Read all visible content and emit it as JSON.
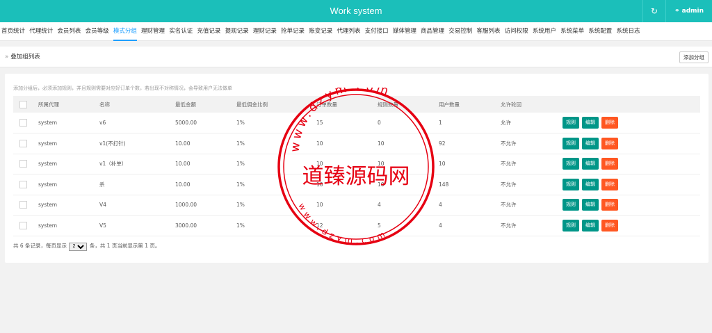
{
  "header": {
    "title": "Work system",
    "refresh_icon": "refresh-icon",
    "user_label": "admin",
    "user_icon": "user-icon"
  },
  "nav": [
    {
      "label": "首页统计"
    },
    {
      "label": "代理统计"
    },
    {
      "label": "会员列表"
    },
    {
      "label": "会员等级"
    },
    {
      "label": "模式分组",
      "active": true
    },
    {
      "label": "理财管理"
    },
    {
      "label": "实名认证"
    },
    {
      "label": "充值记录"
    },
    {
      "label": "提现记录"
    },
    {
      "label": "理财记录"
    },
    {
      "label": "抢单记录"
    },
    {
      "label": "账变记录"
    },
    {
      "label": "代理列表"
    },
    {
      "label": "支付接口"
    },
    {
      "label": "媒体管理"
    },
    {
      "label": "商品管理"
    },
    {
      "label": "交易控制"
    },
    {
      "label": "客服列表"
    },
    {
      "label": "访问权限"
    },
    {
      "label": "系统用户"
    },
    {
      "label": "系统菜单"
    },
    {
      "label": "系统配置"
    },
    {
      "label": "系统日志"
    }
  ],
  "breadcrumb": {
    "label": "叠加组列表",
    "arrow": "»"
  },
  "add_button": "添加分组",
  "notice": "添加分组后，必须添加规则，并且规则需要对应好订单个数，若出现不对称情况，会导致用户无法做单",
  "table": {
    "headers": [
      "所属代理",
      "名称",
      "最低金额",
      "最低佣金比例",
      "订单数量",
      "规则数量",
      "用户数量",
      "允许轮回"
    ],
    "rows": [
      {
        "agent": "system",
        "name": "v6",
        "min_amount": "5000.00",
        "ratio": "1%",
        "orders": "15",
        "rules": "0",
        "users": "1",
        "cycle": "允许"
      },
      {
        "agent": "system",
        "name": "v1(不打针)",
        "min_amount": "10.00",
        "ratio": "1%",
        "orders": "10",
        "rules": "10",
        "users": "92",
        "cycle": "不允许"
      },
      {
        "agent": "system",
        "name": "v1（补单）",
        "min_amount": "10.00",
        "ratio": "1%",
        "orders": "10",
        "rules": "10",
        "users": "10",
        "cycle": "不允许"
      },
      {
        "agent": "system",
        "name": "杀",
        "min_amount": "10.00",
        "ratio": "1%",
        "orders": "10",
        "rules": "10",
        "users": "148",
        "cycle": "不允许"
      },
      {
        "agent": "system",
        "name": "V4",
        "min_amount": "1000.00",
        "ratio": "1%",
        "orders": "10",
        "rules": "4",
        "users": "4",
        "cycle": "不允许"
      },
      {
        "agent": "system",
        "name": "V5",
        "min_amount": "3000.00",
        "ratio": "1%",
        "orders": "12",
        "rules": "5",
        "users": "4",
        "cycle": "不允许"
      }
    ],
    "actions": {
      "rule": "规则",
      "edit": "编辑",
      "delete": "删除"
    }
  },
  "footer": {
    "prefix": "共 6 条记录，每页显示",
    "page_size": "20",
    "suffix": "条，共 1 页当前显示第 1 页。"
  },
  "watermark": {
    "main_text": "道臻源码网",
    "ring_text_top": "www.dzym.com",
    "ring_text_bottom": "www.dzym.com",
    "color": "#e60012"
  },
  "colors": {
    "header": "#1bbfba",
    "green_button": "#009688",
    "red_button": "#ff5722",
    "active_nav": "#1e9fff"
  }
}
